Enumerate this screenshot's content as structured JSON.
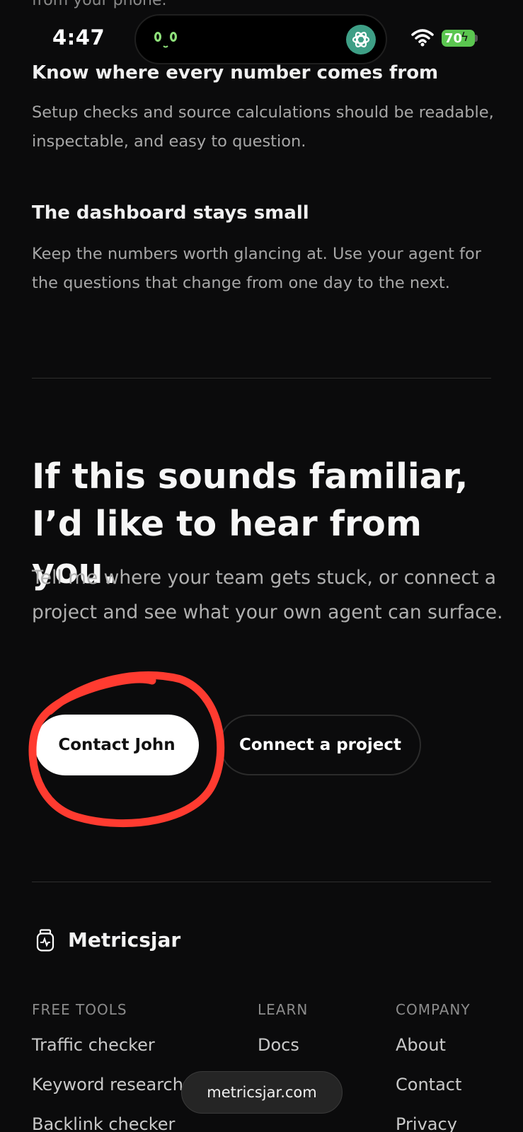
{
  "status_bar": {
    "time": "4:47",
    "battery": "70"
  },
  "top_peek_text": "from your phone.",
  "sections": [
    {
      "title": "Know where every number comes from",
      "body": "Setup checks and source calculations should be readable, inspectable, and easy to question."
    },
    {
      "title": "The dashboard stays small",
      "body": "Keep the numbers worth glancing at. Use your agent for the questions that change from one day to the next."
    }
  ],
  "cta": {
    "headline_line1": "If this sounds familiar,",
    "headline_line2": "I’d like to hear from you.",
    "lead": "Tell me where your team gets stuck, or connect a project and see what your own agent can surface.",
    "primary_label": "Contact John",
    "secondary_label": "Connect a project"
  },
  "annotation": {
    "color": "#ff3b30"
  },
  "footer": {
    "brand": "Metricsjar",
    "columns": [
      {
        "heading": "FREE TOOLS",
        "links": [
          "Traffic checker",
          "Keyword research",
          "Backlink checker"
        ]
      },
      {
        "heading": "LEARN",
        "links": [
          "Docs"
        ]
      },
      {
        "heading": "COMPANY",
        "links": [
          "About",
          "Contact",
          "Privacy"
        ]
      }
    ]
  },
  "browser": {
    "url": "metricsjar.com"
  }
}
